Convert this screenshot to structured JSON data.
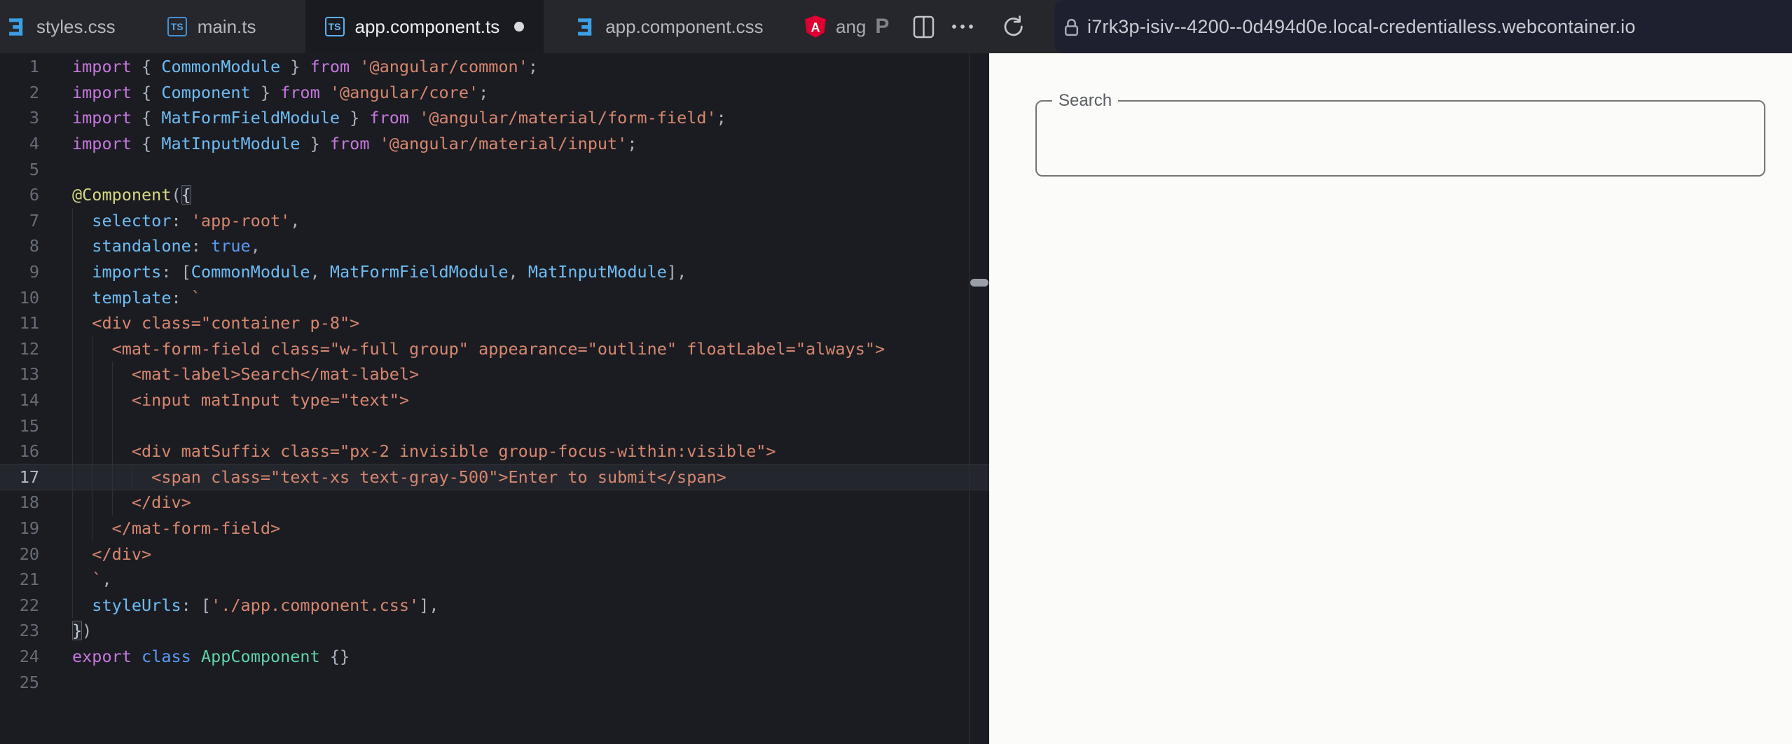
{
  "colors": {
    "accent_blue": "#4596d8",
    "angular_red": "#dd0031",
    "editor_bg": "#1b1c22",
    "tabbar_bg": "#26272c",
    "address_bg": "#1e2030",
    "preview_bg": "#fbfbf9",
    "keyword": "#c678dd",
    "identifier": "#6fbdf4",
    "string": "#d7876f",
    "decorator": "#d6d87e",
    "class_name": "#5fd3a9"
  },
  "icons": {
    "tab_ts": "typescript-badge",
    "tab_css": "css3-badge",
    "angular": "angular-shield",
    "prettier": "prettier-p",
    "split": "split-view",
    "more": "ellipsis",
    "refresh": "reload-arrow",
    "lock": "padlock",
    "divider": "drag-handle"
  },
  "tabs": [
    {
      "label": "styles.css",
      "icon": "css",
      "active": false,
      "dirty": false
    },
    {
      "label": "main.ts",
      "icon": "ts",
      "active": false,
      "dirty": false
    },
    {
      "label": "app.component.ts",
      "icon": "ts",
      "active": true,
      "dirty": true
    },
    {
      "label": "app.component.css",
      "icon": "css",
      "active": false,
      "dirty": false
    }
  ],
  "toolbar": {
    "project_label": "ang",
    "prettier_label": "P"
  },
  "address": {
    "url": "i7rk3p-isiv--4200--0d494d0e.local-credentialless.webcontainer.io"
  },
  "preview": {
    "search_label": "Search",
    "search_value": ""
  },
  "editor": {
    "lines": [
      {
        "n": 1,
        "g": 0,
        "t": [
          [
            "k",
            "import"
          ],
          [
            "p",
            " { "
          ],
          [
            "b",
            "CommonModule"
          ],
          [
            "p",
            " } "
          ],
          [
            "k",
            "from"
          ],
          [
            "p",
            " "
          ],
          [
            "s",
            "'@angular/common'"
          ],
          [
            "p",
            ";"
          ]
        ]
      },
      {
        "n": 2,
        "g": 0,
        "t": [
          [
            "k",
            "import"
          ],
          [
            "p",
            " { "
          ],
          [
            "b",
            "Component"
          ],
          [
            "p",
            " } "
          ],
          [
            "k",
            "from"
          ],
          [
            "p",
            " "
          ],
          [
            "s",
            "'@angular/core'"
          ],
          [
            "p",
            ";"
          ]
        ]
      },
      {
        "n": 3,
        "g": 0,
        "t": [
          [
            "k",
            "import"
          ],
          [
            "p",
            " { "
          ],
          [
            "b",
            "MatFormFieldModule"
          ],
          [
            "p",
            " } "
          ],
          [
            "k",
            "from"
          ],
          [
            "p",
            " "
          ],
          [
            "s",
            "'@angular/material/form-field'"
          ],
          [
            "p",
            ";"
          ]
        ]
      },
      {
        "n": 4,
        "g": 0,
        "t": [
          [
            "k",
            "import"
          ],
          [
            "p",
            " { "
          ],
          [
            "b",
            "MatInputModule"
          ],
          [
            "p",
            " } "
          ],
          [
            "k",
            "from"
          ],
          [
            "p",
            " "
          ],
          [
            "s",
            "'@angular/material/input'"
          ],
          [
            "p",
            ";"
          ]
        ]
      },
      {
        "n": 5,
        "g": 0,
        "t": []
      },
      {
        "n": 6,
        "g": 0,
        "t": [
          [
            "y",
            "@Component"
          ],
          [
            "p",
            "("
          ],
          [
            "x",
            "{"
          ]
        ]
      },
      {
        "n": 7,
        "g": 1,
        "t": [
          [
            "p",
            "  "
          ],
          [
            "b",
            "selector"
          ],
          [
            "p",
            ": "
          ],
          [
            "s",
            "'app-root'"
          ],
          [
            "p",
            ","
          ]
        ]
      },
      {
        "n": 8,
        "g": 1,
        "t": [
          [
            "p",
            "  "
          ],
          [
            "b",
            "standalone"
          ],
          [
            "p",
            ": "
          ],
          [
            "d",
            "true"
          ],
          [
            "p",
            ","
          ]
        ]
      },
      {
        "n": 9,
        "g": 1,
        "t": [
          [
            "p",
            "  "
          ],
          [
            "b",
            "imports"
          ],
          [
            "p",
            ": ["
          ],
          [
            "b",
            "CommonModule"
          ],
          [
            "p",
            ", "
          ],
          [
            "b",
            "MatFormFieldModule"
          ],
          [
            "p",
            ", "
          ],
          [
            "b",
            "MatInputModule"
          ],
          [
            "p",
            "],"
          ]
        ]
      },
      {
        "n": 10,
        "g": 1,
        "t": [
          [
            "p",
            "  "
          ],
          [
            "b",
            "template"
          ],
          [
            "p",
            ": "
          ],
          [
            "s",
            "`"
          ]
        ]
      },
      {
        "n": 11,
        "g": 1,
        "t": [
          [
            "s",
            "  <div class=\"container p-8\">"
          ]
        ]
      },
      {
        "n": 12,
        "g": 2,
        "t": [
          [
            "s",
            "    <mat-form-field class=\"w-full group\" appearance=\"outline\" floatLabel=\"always\">"
          ]
        ]
      },
      {
        "n": 13,
        "g": 3,
        "t": [
          [
            "s",
            "      <mat-label>Search</mat-label>"
          ]
        ]
      },
      {
        "n": 14,
        "g": 3,
        "t": [
          [
            "s",
            "      <input matInput type=\"text\">"
          ]
        ]
      },
      {
        "n": 15,
        "g": 3,
        "t": []
      },
      {
        "n": 16,
        "g": 3,
        "t": [
          [
            "s",
            "      <div matSuffix class=\"px-2 invisible group-focus-within:visible\">"
          ]
        ]
      },
      {
        "n": 17,
        "g": 4,
        "a": 1,
        "t": [
          [
            "s",
            "        <span class=\"text-xs text-gray-500\">Enter to submit</span>"
          ]
        ]
      },
      {
        "n": 18,
        "g": 3,
        "t": [
          [
            "s",
            "      </div>"
          ]
        ]
      },
      {
        "n": 19,
        "g": 2,
        "t": [
          [
            "s",
            "    </mat-form-field>"
          ]
        ]
      },
      {
        "n": 20,
        "g": 1,
        "t": [
          [
            "s",
            "  </div>"
          ]
        ]
      },
      {
        "n": 21,
        "g": 1,
        "t": [
          [
            "p",
            "  "
          ],
          [
            "s",
            "`"
          ],
          [
            "p",
            ","
          ]
        ]
      },
      {
        "n": 22,
        "g": 1,
        "t": [
          [
            "p",
            "  "
          ],
          [
            "b",
            "styleUrls"
          ],
          [
            "p",
            ": ["
          ],
          [
            "s",
            "'./app.component.css'"
          ],
          [
            "p",
            "],"
          ]
        ]
      },
      {
        "n": 23,
        "g": 0,
        "t": [
          [
            "x",
            "}"
          ],
          [
            "p",
            ")"
          ]
        ]
      },
      {
        "n": 24,
        "g": 0,
        "t": [
          [
            "k",
            "export"
          ],
          [
            "p",
            " "
          ],
          [
            "d",
            "class"
          ],
          [
            "p",
            " "
          ],
          [
            "g",
            "AppComponent"
          ],
          [
            "p",
            " {}"
          ]
        ]
      },
      {
        "n": 25,
        "g": 0,
        "t": []
      }
    ]
  }
}
